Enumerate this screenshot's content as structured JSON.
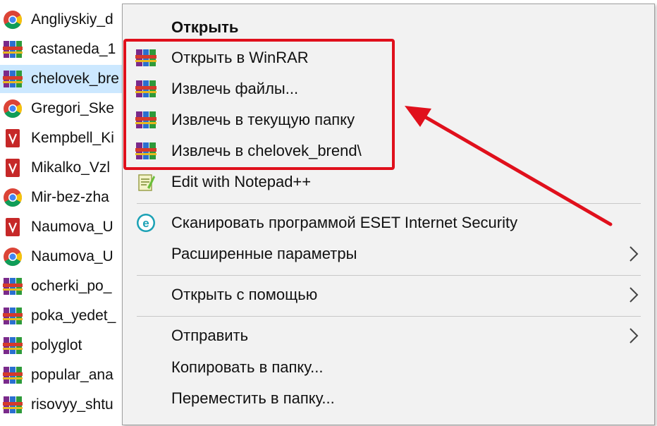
{
  "files": [
    {
      "name": "Angliyskiy_d",
      "icon": "chrome-icon"
    },
    {
      "name": "castaneda_1",
      "icon": "winrar-icon"
    },
    {
      "name": "chelovek_bre",
      "icon": "winrar-icon"
    },
    {
      "name": "Gregori_Ske",
      "icon": "chrome-icon"
    },
    {
      "name": "Kempbell_Ki",
      "icon": "pdf-icon"
    },
    {
      "name": "Mikalko_Vzl",
      "icon": "pdf-icon"
    },
    {
      "name": "Mir-bez-zha",
      "icon": "chrome-icon"
    },
    {
      "name": "Naumova_U",
      "icon": "pdf-icon"
    },
    {
      "name": "Naumova_U",
      "icon": "chrome-icon"
    },
    {
      "name": "ocherki_po_",
      "icon": "winrar-icon"
    },
    {
      "name": "poka_yedet_",
      "icon": "winrar-icon"
    },
    {
      "name": "polyglot",
      "icon": "winrar-icon"
    },
    {
      "name": "popular_ana",
      "icon": "winrar-icon"
    },
    {
      "name": "risovyy_shtu",
      "icon": "winrar-icon"
    }
  ],
  "menu": {
    "open": "Открыть",
    "open_winrar": "Открыть в WinRAR",
    "extract_files": "Извлечь файлы...",
    "extract_here": "Извлечь в текущую папку",
    "extract_to": "Извлечь в chelovek_brend\\",
    "edit_notepad": "Edit with Notepad++",
    "scan_eset": "Сканировать программой ESET Internet Security",
    "advanced": "Расширенные параметры",
    "open_with": "Открыть с помощью",
    "send_to": "Отправить",
    "copy_to": "Копировать в папку...",
    "move_to": "Переместить в папку..."
  },
  "colors": {
    "highlight": "#e0101c",
    "selection": "#cce8ff",
    "menu_bg": "#f2f2f2"
  }
}
